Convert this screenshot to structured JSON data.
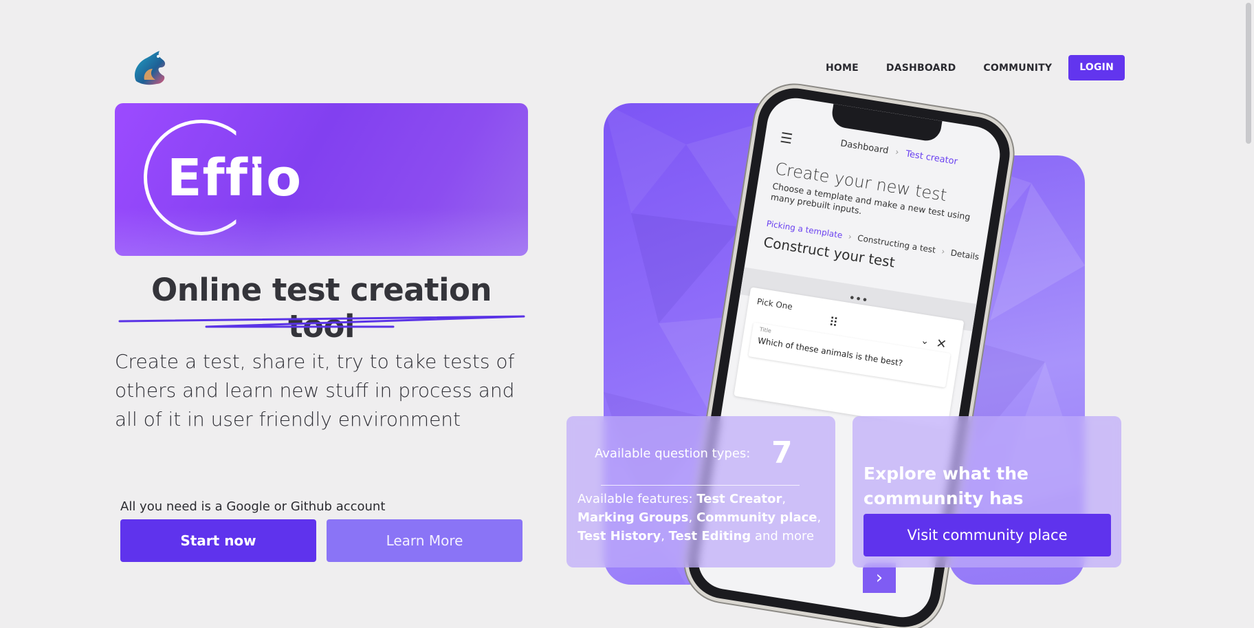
{
  "nav": {
    "items": [
      "HOME",
      "DASHBOARD",
      "COMMUNITY"
    ],
    "login": "LOGIN"
  },
  "hero": {
    "brand": "Effio",
    "headline": "Online test creation tool",
    "description": "Create a test, share it, try to take tests of others and learn new stuff in process and all of it in user friendly environment",
    "note": "All you need is a Google or Github account",
    "start_button": "Start now",
    "learn_button": "Learn More"
  },
  "phone": {
    "breadcrumb_home": "Dashboard",
    "breadcrumb_sep": "›",
    "breadcrumb_current": "Test creator",
    "title": "Create your new test",
    "subtitle": "Choose a template and make a new test using many prebuilt inputs.",
    "steps": [
      "Picking a template",
      "Constructing a test",
      "Details"
    ],
    "construct_title": "Construct your test",
    "band_dots": "•••",
    "question_type": "Pick One",
    "field_label": "Title",
    "field_value": "Which of these animals is the best?"
  },
  "stats": {
    "question_types_label": "Available question types:",
    "question_types_count": "7",
    "features_prefix": "Available features: ",
    "features": [
      "Test Creator",
      "Marking Groups",
      "Community place",
      "Test History",
      "Test Editing"
    ],
    "features_suffix": " and more"
  },
  "community": {
    "heading": "Explore what the communnity has created!",
    "button": "Visit community place"
  },
  "colors": {
    "accent": "#6235ee",
    "accent_light": "#8a74f6",
    "background": "#efeeef"
  }
}
